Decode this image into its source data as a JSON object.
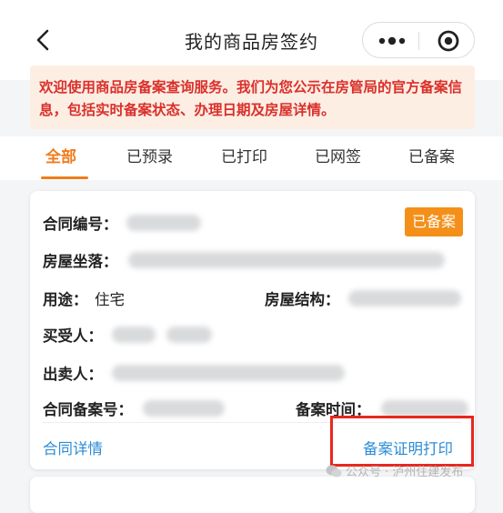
{
  "header": {
    "title": "我的商品房签约",
    "back_icon": "chevron-left-icon",
    "more_icon": "more-dots-icon",
    "close_icon": "target-close-icon"
  },
  "notice": {
    "text": "欢迎使用商品房备案查询服务。我们为您公示在房管局的官方备案信息，包括实时备案状态、办理日期及房屋详情。",
    "color": "#d9302a",
    "background": "#fdeee4"
  },
  "tabs": [
    {
      "label": "全部",
      "active": true
    },
    {
      "label": "已预录",
      "active": false
    },
    {
      "label": "已打印",
      "active": false
    },
    {
      "label": "已网签",
      "active": false
    },
    {
      "label": "已备案",
      "active": false
    }
  ],
  "accent_color": "#f07c1e",
  "card": {
    "status_badge": "已备案",
    "fields": {
      "contract_no": {
        "label": "合同编号："
      },
      "location": {
        "label": "房屋坐落："
      },
      "usage": {
        "label": "用途：",
        "value": "住宅"
      },
      "structure": {
        "label": "房屋结构："
      },
      "buyer": {
        "label": "买受人："
      },
      "seller": {
        "label": "出卖人："
      },
      "filing_no": {
        "label": "合同备案号："
      },
      "filing_time": {
        "label": "备案时间："
      }
    },
    "links": {
      "details": "合同详情",
      "print_certificate": "备案证明打印"
    },
    "link_color": "#2d8cd6"
  },
  "watermark": "公众号 · 泸州住建发布"
}
